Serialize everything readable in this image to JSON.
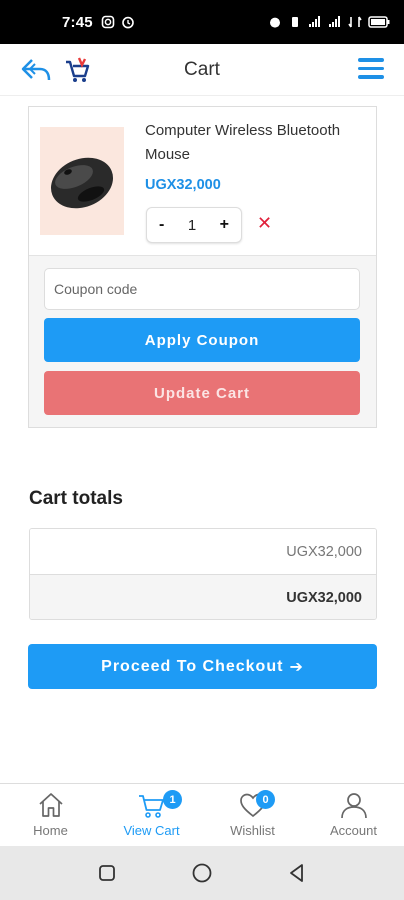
{
  "status_bar": {
    "time": "7:45"
  },
  "header": {
    "title": "Cart"
  },
  "cart_item": {
    "name": "Computer Wireless Bluetooth Mouse",
    "price": "UGX32,000",
    "quantity": "1",
    "minus_label": "-",
    "plus_label": "+",
    "remove_label": "✕"
  },
  "coupon": {
    "placeholder": "Coupon code",
    "apply_label": "Apply Coupon",
    "update_label": "Update Cart"
  },
  "totals": {
    "heading": "Cart totals",
    "subtotal": "UGX32,000",
    "total": "UGX32,000"
  },
  "checkout": {
    "label": "Proceed To Checkout",
    "arrow": "➔"
  },
  "bottom_nav": {
    "items": [
      {
        "label": "Home",
        "icon": "home-icon"
      },
      {
        "label": "View Cart",
        "icon": "cart-icon",
        "badge": "1",
        "active": true
      },
      {
        "label": "Wishlist",
        "icon": "heart-icon",
        "badge": "0"
      },
      {
        "label": "Account",
        "icon": "user-icon"
      }
    ]
  },
  "colors": {
    "accent": "#1e9bf5",
    "update_button": "#e97375",
    "remove": "#e0203a"
  }
}
